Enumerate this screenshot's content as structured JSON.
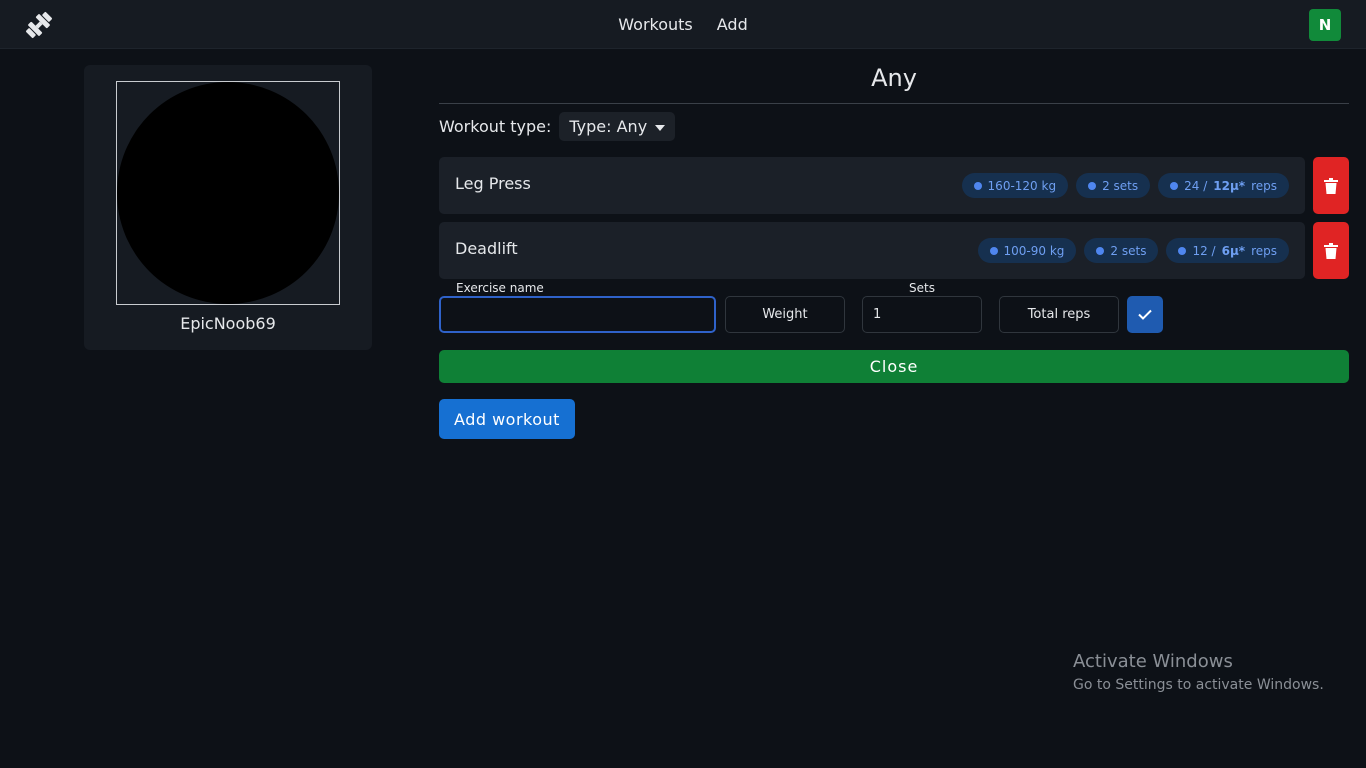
{
  "nav": {
    "links": [
      "Workouts",
      "Add"
    ],
    "user_initial": "N"
  },
  "profile": {
    "username": "EpicNoob69"
  },
  "main": {
    "title": "Any",
    "type_label": "Workout type:",
    "type_value": "Type: Any"
  },
  "exercises": [
    {
      "name": "Leg Press",
      "weight": "160-120 kg",
      "sets": "2 sets",
      "reps_prefix": "24 /",
      "reps_bold": "12μ*",
      "reps_suffix": "reps"
    },
    {
      "name": "Deadlift",
      "weight": "100-90 kg",
      "sets": "2 sets",
      "reps_prefix": "12 /",
      "reps_bold": "6μ*",
      "reps_suffix": "reps"
    }
  ],
  "form": {
    "exercise_name_label": "Exercise name",
    "exercise_name_value": "",
    "weight_placeholder": "Weight",
    "sets_label": "Sets",
    "sets_value": "1",
    "total_reps_placeholder": "Total reps"
  },
  "buttons": {
    "close": "Close",
    "add_workout": "Add workout"
  },
  "watermark": {
    "title": "Activate Windows",
    "subtitle": "Go to Settings to activate Windows."
  },
  "colors": {
    "background": "#0d1117",
    "panel": "#161b22",
    "accent_green": "#0f8036",
    "accent_blue": "#1670d2",
    "danger": "#e02424",
    "chip_text": "#6f9ff2"
  }
}
